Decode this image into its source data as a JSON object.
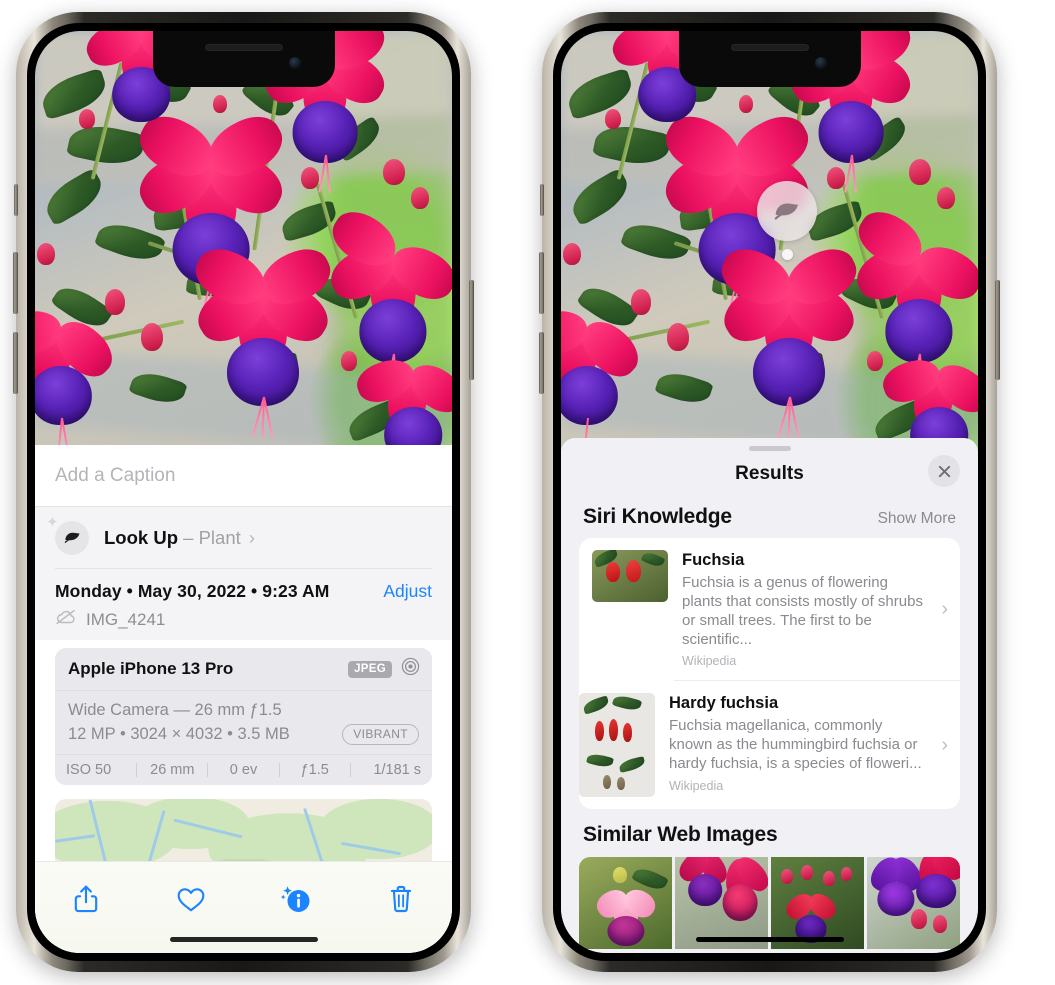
{
  "left_phone": {
    "name": "photos-detail-screen",
    "caption": {
      "placeholder": "Add a Caption",
      "value": ""
    },
    "look_up": {
      "icon": "leaf-icon",
      "sparkle_icon": "sparkle-icon",
      "label": "Look Up",
      "dash": "–",
      "subject": "Plant",
      "chevron": "›"
    },
    "date_line": {
      "text": "Monday • May 30, 2022 • 9:23 AM",
      "adjust_label": "Adjust",
      "adjust_color": "#1b84ff"
    },
    "file": {
      "icon": "cloud-slash-icon",
      "name": "IMG_4241"
    },
    "camera_card": {
      "model": "Apple iPhone 13 Pro",
      "format_badge": "JPEG",
      "aperture_icon": "aperture-icon",
      "lens": "Wide Camera — 26 mm ƒ1.5",
      "meta": "12 MP • 3024 × 4032 • 3.5 MB",
      "style_badge": "VIBRANT",
      "exif": [
        "ISO 50",
        "26 mm",
        "0 ev",
        "ƒ1.5",
        "1/181 s"
      ]
    },
    "toolbar": [
      {
        "name": "share-button",
        "icon": "share-icon"
      },
      {
        "name": "favorite-button",
        "icon": "heart-icon"
      },
      {
        "name": "info-button",
        "icon": "info-sparkle-icon"
      },
      {
        "name": "delete-button",
        "icon": "trash-icon"
      }
    ]
  },
  "right_phone": {
    "name": "visual-look-up-results-screen",
    "photo_badge": {
      "icon": "leaf-icon",
      "name": "visual-look-up-badge"
    },
    "sheet": {
      "grabber": "drag-handle",
      "title": "Results",
      "close_icon": "close-icon"
    },
    "siri_knowledge": {
      "title": "Siri Knowledge",
      "action": "Show More",
      "items": [
        {
          "title": "Fuchsia",
          "description": "Fuchsia is a genus of flowering plants that consists mostly of shrubs or small trees. The first to be scientific...",
          "source": "Wikipedia",
          "chevron": "›"
        },
        {
          "title": "Hardy fuchsia",
          "description": "Fuchsia magellanica, commonly known as the hummingbird fuchsia or hardy fuchsia, is a species of floweri...",
          "source": "Wikipedia",
          "chevron": "›"
        }
      ]
    },
    "similar_web_images": {
      "title": "Similar Web Images",
      "thumb_count": 4
    }
  }
}
